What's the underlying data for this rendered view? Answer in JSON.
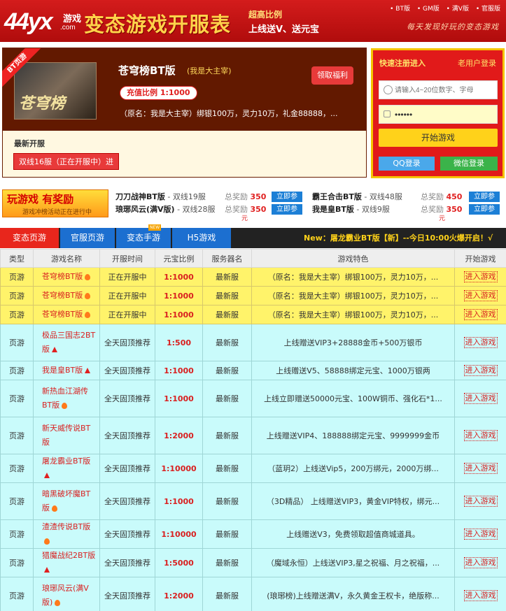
{
  "header": {
    "logo_big": "44yx",
    "logo_small1": "游戏",
    "logo_small2": ".com",
    "title": "变态游戏开服表",
    "slogan1": "超高比例",
    "slogan2": "上线送V、送元宝",
    "links": [
      "• BT版",
      "• GM版",
      "• 满V版",
      "• 官服版"
    ],
    "motto": "每天发现好玩的变态游戏"
  },
  "featured": {
    "ribbon": "BT页游",
    "cover_text": "苍穹榜",
    "name": "苍穹榜BT版",
    "slogan": "(我是大主宰)",
    "ratio": "充值比例 1:1000",
    "desc": "（原名：我是大主宰）绑银100万，灵力10万，礼金88888，...",
    "gift_button": "领取福利",
    "latest_title": "最新开服",
    "latest_server": "双线16服（正在开服中）进"
  },
  "login": {
    "quick_register": "快速注册进入",
    "old_user": "老用户登录",
    "username_placeholder": "请输入4~20位数字、字母",
    "password_value": "••••••",
    "start_button": "开始游戏",
    "qq_button": "QQ登录",
    "wechat_button": "微信登录"
  },
  "promo": {
    "banner_title": "玩游戏 有奖励",
    "banner_sub": "游戏冲榜活动正在进行中",
    "reward_label": "总奖励",
    "join_label": "立即参",
    "items": [
      {
        "name": "刀刀战神BT版",
        "server": " - 双线19服",
        "amount": "350"
      },
      {
        "name": "霸王合击BT版",
        "server": " - 双线48服",
        "amount": "450"
      },
      {
        "name": "琅琊风云(满V版)",
        "server": " - 双线28服",
        "amount": "350"
      },
      {
        "name": "我是皇BT版",
        "server": " - 双线9服",
        "amount": "350"
      }
    ],
    "currency": "元"
  },
  "tabs": [
    "变态页游",
    "官服页游",
    "变态手游",
    "H5游戏"
  ],
  "new_badge": "NEW",
  "marquee": "New：屠龙霸业BT版【新】--今日10:00火爆开启！√",
  "table": {
    "headers": [
      "类型",
      "游戏名称",
      "开服时间",
      "元宝比例",
      "服务器名",
      "游戏特色",
      "开始游戏"
    ],
    "rows": [
      {
        "type": "页游",
        "name": "苍穹榜BT版",
        "icon": "fire-icon",
        "time": "正在开服中",
        "ratio": "1:1000",
        "server": "最新服",
        "feature": "（原名：我是大主宰）绑银100万，灵力10万，...",
        "action": "进入游戏",
        "style": "hot"
      },
      {
        "type": "页游",
        "name": "苍穹榜BT版",
        "icon": "fire-icon",
        "time": "正在开服中",
        "ratio": "1:1000",
        "server": "最新服",
        "feature": "（原名：我是大主宰）绑银100万，灵力10万，...",
        "action": "进入游戏",
        "style": "hot"
      },
      {
        "type": "页游",
        "name": "苍穹榜BT版",
        "icon": "fire-icon",
        "time": "正在开服中",
        "ratio": "1:1000",
        "server": "最新服",
        "feature": "（原名：我是大主宰）绑银100万，灵力10万，...",
        "action": "进入游戏",
        "style": "hot"
      },
      {
        "type": "页游",
        "name": "极品三国志2BT版",
        "icon": "up-arrow-icon",
        "time": "全天固顶推荐",
        "ratio": "1:500",
        "server": "最新服",
        "feature": "上线赠送VIP3+28888金币+500万银币",
        "action": "进入游戏",
        "style": "rec"
      },
      {
        "type": "页游",
        "name": "我是皇BT版",
        "icon": "up-arrow-icon",
        "time": "全天固顶推荐",
        "ratio": "1:1000",
        "server": "最新服",
        "feature": "上线赠送V5、58888绑定元宝、1000万银两",
        "action": "进入游戏",
        "style": "rec"
      },
      {
        "type": "页游",
        "name": "新热血江湖传BT版",
        "icon": "fire-icon",
        "time": "全天固顶推荐",
        "ratio": "1:1000",
        "server": "最新服",
        "feature": "上线立即赠送50000元宝、100W铜币、强化石*1...",
        "action": "进入游戏",
        "style": "rec"
      },
      {
        "type": "页游",
        "name": "新天威传说BT版",
        "icon": "",
        "time": "全天固顶推荐",
        "ratio": "1:2000",
        "server": "最新服",
        "feature": "上线赠送VIP4、188888绑定元宝、9999999金币",
        "action": "进入游戏",
        "style": "rec"
      },
      {
        "type": "页游",
        "name": "屠龙霸业BT版",
        "icon": "up-arrow-icon",
        "time": "全天固顶推荐",
        "ratio": "1:10000",
        "server": "最新服",
        "feature": "（蓝玥2）上线送Vip5，200万绑元，2000万绑...",
        "action": "进入游戏",
        "style": "rec"
      },
      {
        "type": "页游",
        "name": "暗黑破坏魔BT版",
        "icon": "fire-icon",
        "time": "全天固顶推荐",
        "ratio": "1:1000",
        "server": "最新服",
        "feature": "（3D精品） 上线赠送VIP3，黄金VIP特权，绑元...",
        "action": "进入游戏",
        "style": "rec"
      },
      {
        "type": "页游",
        "name": "渣渣传说BT版",
        "icon": "fire-icon",
        "time": "全天固顶推荐",
        "ratio": "1:10000",
        "server": "最新服",
        "feature": "上线赠送V3，免费领取超值商城道具。",
        "action": "进入游戏",
        "style": "rec"
      },
      {
        "type": "页游",
        "name": "猎魔战纪2BT版",
        "icon": "up-arrow-icon",
        "time": "全天固顶推荐",
        "ratio": "1:5000",
        "server": "最新服",
        "feature": "（魔域永恒）上线送VIP3,星之祝福、月之祝福，...",
        "action": "进入游戏",
        "style": "rec"
      },
      {
        "type": "页游",
        "name": "琅琊风云(满V版)",
        "icon": "fire-icon",
        "time": "全天固顶推荐",
        "ratio": "1:2000",
        "server": "最新服",
        "feature": "(琅琊榜)上线赠送满V，永久黄金王权卡，绝版称...",
        "action": "进入游戏",
        "style": "rec"
      }
    ]
  }
}
